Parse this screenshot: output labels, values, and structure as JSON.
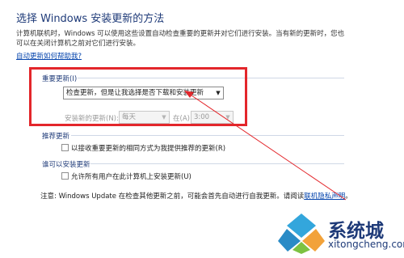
{
  "page": {
    "title": "选择 Windows 安装更新的方法",
    "description": [
      "计算机联机时，Windows 可以使用这些设置自动检查重要的更新并对它们进行安装。当有新的更新时，您也",
      "可以在关闭计算机之前对它们进行安装。"
    ],
    "help_link": "自动更新如何帮助我?"
  },
  "important": {
    "header": "重要更新(I)",
    "dropdown_value": "检查更新，但是让我选择是否下载和安装更新",
    "install_label": "安装新的更新(N):",
    "day_value": "每天",
    "at_label": "在(A)",
    "time_value": "3:00"
  },
  "recommended": {
    "header": "推荐更新",
    "checkbox_label": "以接收重要更新的相同方式为我提供推荐的更新(R)"
  },
  "who": {
    "header": "谁可以安装更新",
    "checkbox_label": "允许所有用户在此计算机上安装更新(U)"
  },
  "note": {
    "text": "注意: Windows Update 在检查其他更新之前，可能会首先自动进行自我更新。请阅读",
    "link": "联机隐私声明",
    "end": "。"
  },
  "watermark": {
    "brand": "系统城",
    "url": "xitongcheng.com"
  },
  "colors": {
    "accent": "#1e3a78",
    "link": "#0645ad",
    "highlight_box": "#e3262b"
  }
}
